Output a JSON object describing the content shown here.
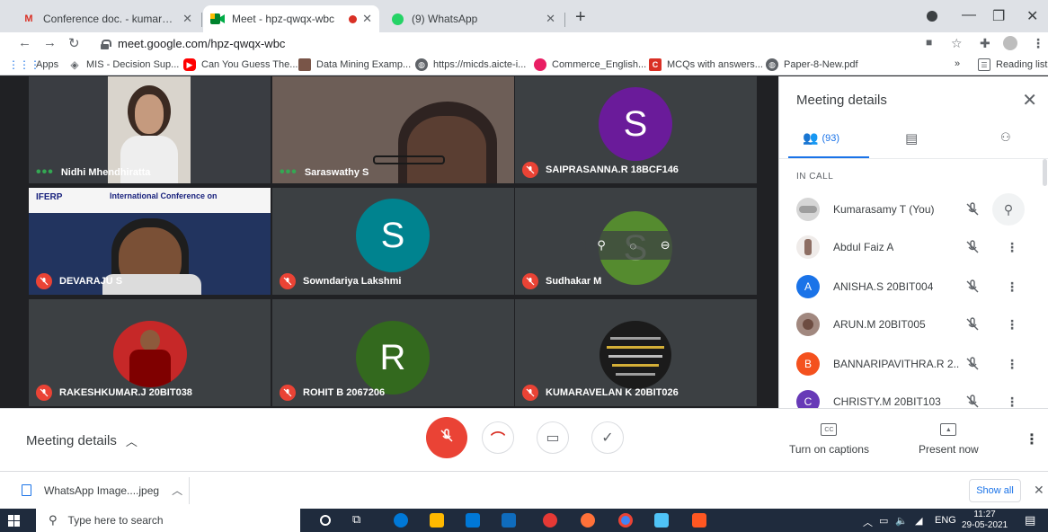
{
  "browser": {
    "tabs": [
      {
        "label": "Conference doc. - kumarasamyt@",
        "icon": "gmail-icon"
      },
      {
        "label": "Meet - hpz-qwqx-wbc",
        "icon": "meet-icon"
      },
      {
        "label": "(9) WhatsApp",
        "icon": "whatsapp-icon"
      }
    ],
    "url": "meet.google.com/hpz-qwqx-wbc",
    "bookmarks": [
      {
        "label": "Apps",
        "icon": "apps-grid-icon",
        "color": "#1a73e8"
      },
      {
        "label": "MIS - Decision Sup...",
        "icon": "mis-icon",
        "color": "#5f6368"
      },
      {
        "label": "Can You Guess The...",
        "icon": "youtube-icon",
        "color": "#ff0000"
      },
      {
        "label": "Data Mining Examp...",
        "icon": "datamining-icon",
        "color": "#795548"
      },
      {
        "label": "https://micds.aicte-i...",
        "icon": "globe-icon",
        "color": "#5f6368"
      },
      {
        "label": "Commerce_English...",
        "icon": "commerce-icon",
        "color": "#e91e63"
      },
      {
        "label": "MCQs with answers...",
        "icon": "mcq-icon",
        "color": "#d93025"
      },
      {
        "label": "Paper-8-New.pdf",
        "icon": "globe-icon",
        "color": "#5f6368"
      }
    ],
    "bookmarks_more": "»",
    "reading_list": "Reading list"
  },
  "tiles": [
    {
      "name": "Nidhi Mhendhiratta",
      "status": "speaking"
    },
    {
      "name": "Saraswathy S",
      "status": "speaking"
    },
    {
      "name": "SAIPRASANNA.R 18BCF146",
      "status": "muted",
      "initial": "S",
      "color": "#6a1b9a"
    },
    {
      "name": "DEVARAJU S",
      "status": "muted"
    },
    {
      "name": "Sowndariya Lakshmi",
      "status": "muted",
      "initial": "S",
      "color": "#00838f"
    },
    {
      "name": "Sudhakar M",
      "status": "muted",
      "initial": "S",
      "color": "#558b2f"
    },
    {
      "name": "RAKESHKUMAR.J 20BIT038",
      "status": "muted"
    },
    {
      "name": "ROHIT B 2067206",
      "status": "muted",
      "initial": "R",
      "color": "#33691e"
    },
    {
      "name": "KUMARAVELAN K 20BIT026",
      "status": "muted"
    }
  ],
  "slide_text": {
    "org": "IFERP",
    "title": "International Conference on"
  },
  "panel": {
    "title": "Meeting details",
    "people_count": "(93)",
    "section": "IN CALL",
    "participants": [
      {
        "name": "Kumarasamy T (You)",
        "avatar": "photo",
        "color": "#c9c9c9"
      },
      {
        "name": "Abdul Faiz A",
        "avatar": "photo",
        "color": "#d7ccc8"
      },
      {
        "name": "ANISHA.S 20BIT004",
        "avatar": "A",
        "color": "#1a73e8"
      },
      {
        "name": "ARUN.M 20BIT005",
        "avatar": "photo",
        "color": "#bcaaa4"
      },
      {
        "name": "BANNARIPAVITHRA.R 2...",
        "avatar": "B",
        "color": "#f4511e"
      },
      {
        "name": "CHRISTY.M 20BIT103",
        "avatar": "C",
        "color": "#673ab7"
      }
    ]
  },
  "controls": {
    "meeting_details": "Meeting details",
    "captions": "Turn on captions",
    "present": "Present now",
    "captions_icon_text": "CC"
  },
  "download": {
    "file": "WhatsApp Image....jpeg",
    "show_all": "Show all"
  },
  "taskbar": {
    "search": "Type here to search",
    "lang": "ENG",
    "time": "11:27",
    "date": "29-05-2021"
  }
}
